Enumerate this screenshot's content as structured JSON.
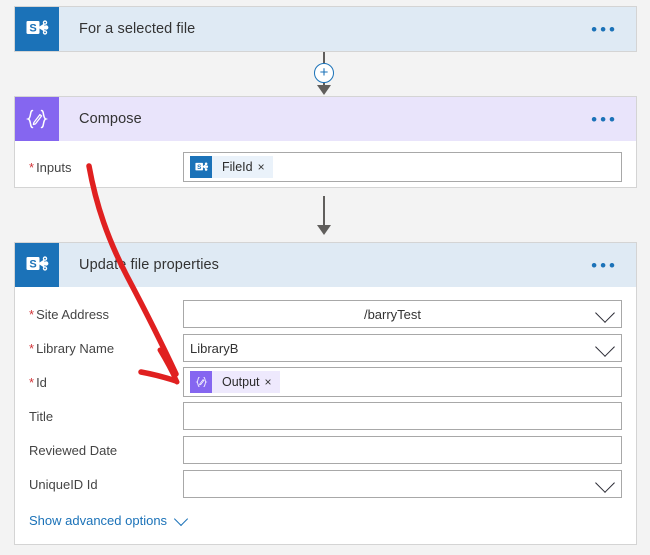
{
  "flow": {
    "trigger_card": {
      "icon": "sharepoint-icon",
      "title": "For a selected file",
      "menu": "•••",
      "header_color": "#dfeaf4",
      "icon_color": "#1b72b8"
    },
    "connector_1": {
      "add_button_label": "+"
    },
    "compose_card": {
      "icon": "compose-icon",
      "title": "Compose",
      "menu": "•••",
      "header_color": "#e9e4fb",
      "icon_color": "#8566f0",
      "fields": [
        {
          "label": "Inputs",
          "required": true,
          "token": {
            "icon": "sharepoint-icon",
            "text": "FileId",
            "remove": "×"
          }
        }
      ]
    },
    "connector_2": {},
    "update_card": {
      "icon": "sharepoint-icon",
      "title": "Update file properties",
      "menu": "•••",
      "header_color": "#dfeaf4",
      "icon_color": "#1b72b8",
      "fields": [
        {
          "label": "Site Address",
          "required": true,
          "value": "/barryTest",
          "align": "mid",
          "dropdown": true
        },
        {
          "label": "Library Name",
          "required": true,
          "value": "LibraryB",
          "align": "left",
          "dropdown": true
        },
        {
          "label": "Id",
          "required": true,
          "value": "",
          "align": "left",
          "dropdown": false,
          "token": {
            "icon": "compose-icon",
            "text": "Output",
            "remove": "×"
          }
        },
        {
          "label": "Title",
          "required": false,
          "value": "",
          "align": "left",
          "dropdown": false
        },
        {
          "label": "Reviewed Date",
          "required": false,
          "value": "",
          "align": "left",
          "dropdown": false
        },
        {
          "label": "UniqueID Id",
          "required": false,
          "value": "",
          "align": "left",
          "dropdown": true
        }
      ],
      "advanced_link": "Show advanced options"
    }
  },
  "annotation": {
    "name": "red-arrow-annotation",
    "color": "#e02020",
    "points_from": "Inputs",
    "points_to": "Id"
  }
}
